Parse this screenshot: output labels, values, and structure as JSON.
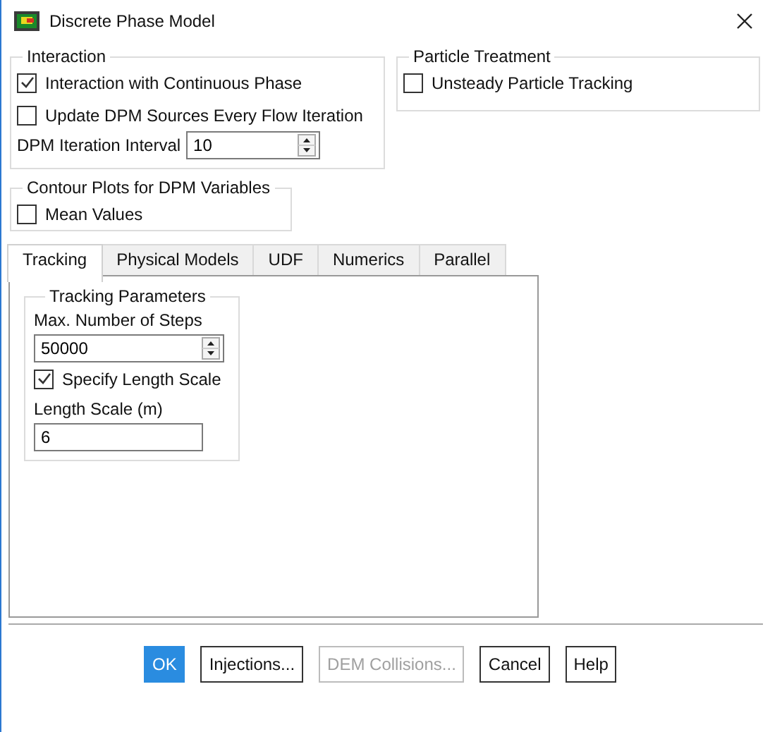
{
  "window": {
    "title": "Discrete Phase Model"
  },
  "interaction": {
    "title": "Interaction",
    "options": [
      {
        "label": "Interaction with Continuous Phase",
        "checked": true
      },
      {
        "label": "Update DPM Sources Every Flow Iteration",
        "checked": false
      }
    ],
    "interval": {
      "label": "DPM Iteration Interval",
      "value": "10"
    }
  },
  "particle_treatment": {
    "title": "Particle Treatment",
    "options": [
      {
        "label": "Unsteady Particle Tracking",
        "checked": false
      }
    ]
  },
  "contour_plots": {
    "title": "Contour Plots for DPM Variables",
    "options": [
      {
        "label": "Mean Values",
        "checked": false
      }
    ]
  },
  "tabs": [
    {
      "label": "Tracking",
      "selected": true
    },
    {
      "label": "Physical Models",
      "selected": false
    },
    {
      "label": "UDF",
      "selected": false
    },
    {
      "label": "Numerics",
      "selected": false
    },
    {
      "label": "Parallel",
      "selected": false
    }
  ],
  "tracking_parameters": {
    "title": "Tracking Parameters",
    "max_steps": {
      "label": "Max. Number of Steps",
      "value": "50000"
    },
    "specify_length_scale": {
      "label": "Specify Length Scale",
      "checked": true
    },
    "length_scale": {
      "label": "Length Scale (m)",
      "value": "6"
    }
  },
  "buttons": [
    {
      "label": "OK",
      "default": true,
      "disabled": false
    },
    {
      "label": "Injections...",
      "default": false,
      "disabled": false
    },
    {
      "label": "DEM Collisions...",
      "default": false,
      "disabled": true
    },
    {
      "label": "Cancel",
      "default": false,
      "disabled": false
    },
    {
      "label": "Help",
      "default": false,
      "disabled": false
    }
  ]
}
